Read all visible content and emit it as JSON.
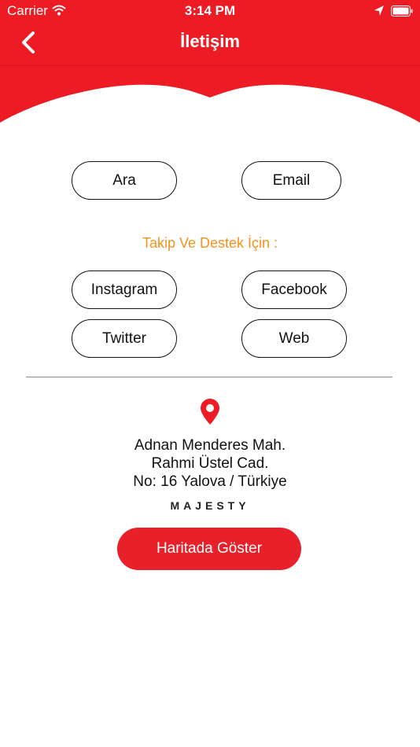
{
  "status_bar": {
    "carrier": "Carrier",
    "time": "3:14 PM"
  },
  "header": {
    "title": "İletişim",
    "color": "#ED1C24"
  },
  "contact_buttons": {
    "call_label": "Ara",
    "email_label": "Email"
  },
  "social": {
    "section_label": "Takip Ve Destek İçin :",
    "instagram_label": "Instagram",
    "facebook_label": "Facebook",
    "twitter_label": "Twitter",
    "web_label": "Web"
  },
  "address": {
    "line1": "Adnan Menderes Mah.",
    "line2": "Rahmi Üstel Cad.",
    "line3": "No: 16 Yalova / Türkiye",
    "brand": "MAJESTY"
  },
  "map_button_label": "Haritada Göster",
  "icons": {
    "back": "chevron-left-icon",
    "pin": "location-pin-icon",
    "wifi": "wifi-icon",
    "location_arrow": "location-arrow-icon",
    "battery": "battery-icon"
  },
  "colors": {
    "accent": "#ED1C24",
    "label_orange": "#F5911E"
  }
}
